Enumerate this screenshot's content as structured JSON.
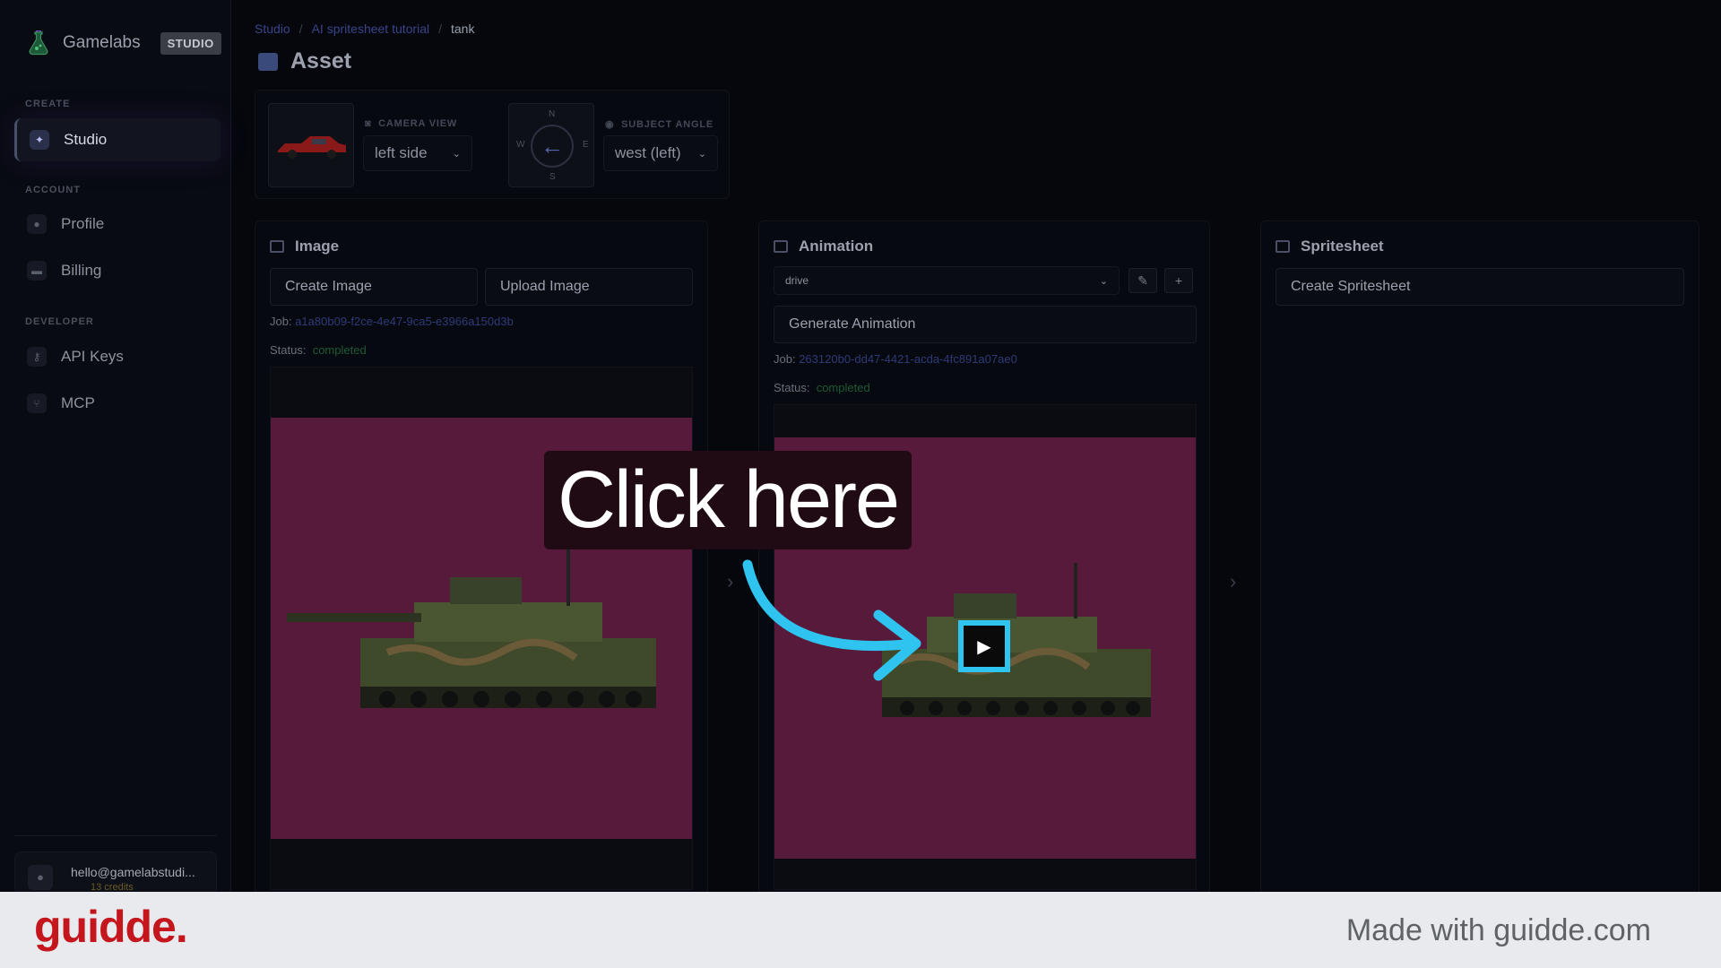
{
  "brand": {
    "name": "Gamelabs",
    "badge": "STUDIO"
  },
  "sidebar": {
    "sections": [
      {
        "label": "CREATE",
        "items": [
          {
            "label": "Studio",
            "icon": "wand-icon",
            "active": true
          }
        ]
      },
      {
        "label": "ACCOUNT",
        "items": [
          {
            "label": "Profile",
            "icon": "user-icon"
          },
          {
            "label": "Billing",
            "icon": "card-icon"
          }
        ]
      },
      {
        "label": "DEVELOPER",
        "items": [
          {
            "label": "API Keys",
            "icon": "key-icon"
          },
          {
            "label": "MCP",
            "icon": "branch-icon"
          }
        ]
      }
    ],
    "user": {
      "email": "hello@gamelabstudi...",
      "credits": "13 credits"
    }
  },
  "breadcrumb": {
    "items": [
      "Studio",
      "AI spritesheet tutorial"
    ],
    "current": "tank",
    "sep": "/"
  },
  "page": {
    "title": "Asset"
  },
  "config": {
    "camera_view_label": "CAMERA VIEW",
    "camera_view_value": "left side",
    "subject_angle_label": "SUBJECT ANGLE",
    "subject_angle_value": "west (left)",
    "compass": {
      "n": "N",
      "s": "S",
      "e": "E",
      "w": "W"
    }
  },
  "image_panel": {
    "title": "Image",
    "create_label": "Create Image",
    "upload_label": "Upload Image",
    "job_prefix": "Job:",
    "job_id": "a1a80b09-f2ce-4e47-9ca5-e3966a150d3b",
    "status_prefix": "Status:",
    "status": "completed"
  },
  "animation_panel": {
    "title": "Animation",
    "animation_select": "drive",
    "generate_label": "Generate Animation",
    "job_prefix": "Job:",
    "job_id": "263120b0-dd47-4421-acda-4fc891a07ae0",
    "status_prefix": "Status:",
    "status": "completed"
  },
  "spritesheet_panel": {
    "title": "Spritesheet",
    "create_label": "Create Spritesheet"
  },
  "overlay": {
    "callout": "Click here",
    "accent": "#2ec4ef"
  },
  "footer": {
    "logo": "guidde.",
    "text": "Made with guidde.com"
  },
  "colors": {
    "magenta_bg": "#581a3a",
    "status_completed": "#1e5a34",
    "footer_logo": "#c4161c"
  }
}
